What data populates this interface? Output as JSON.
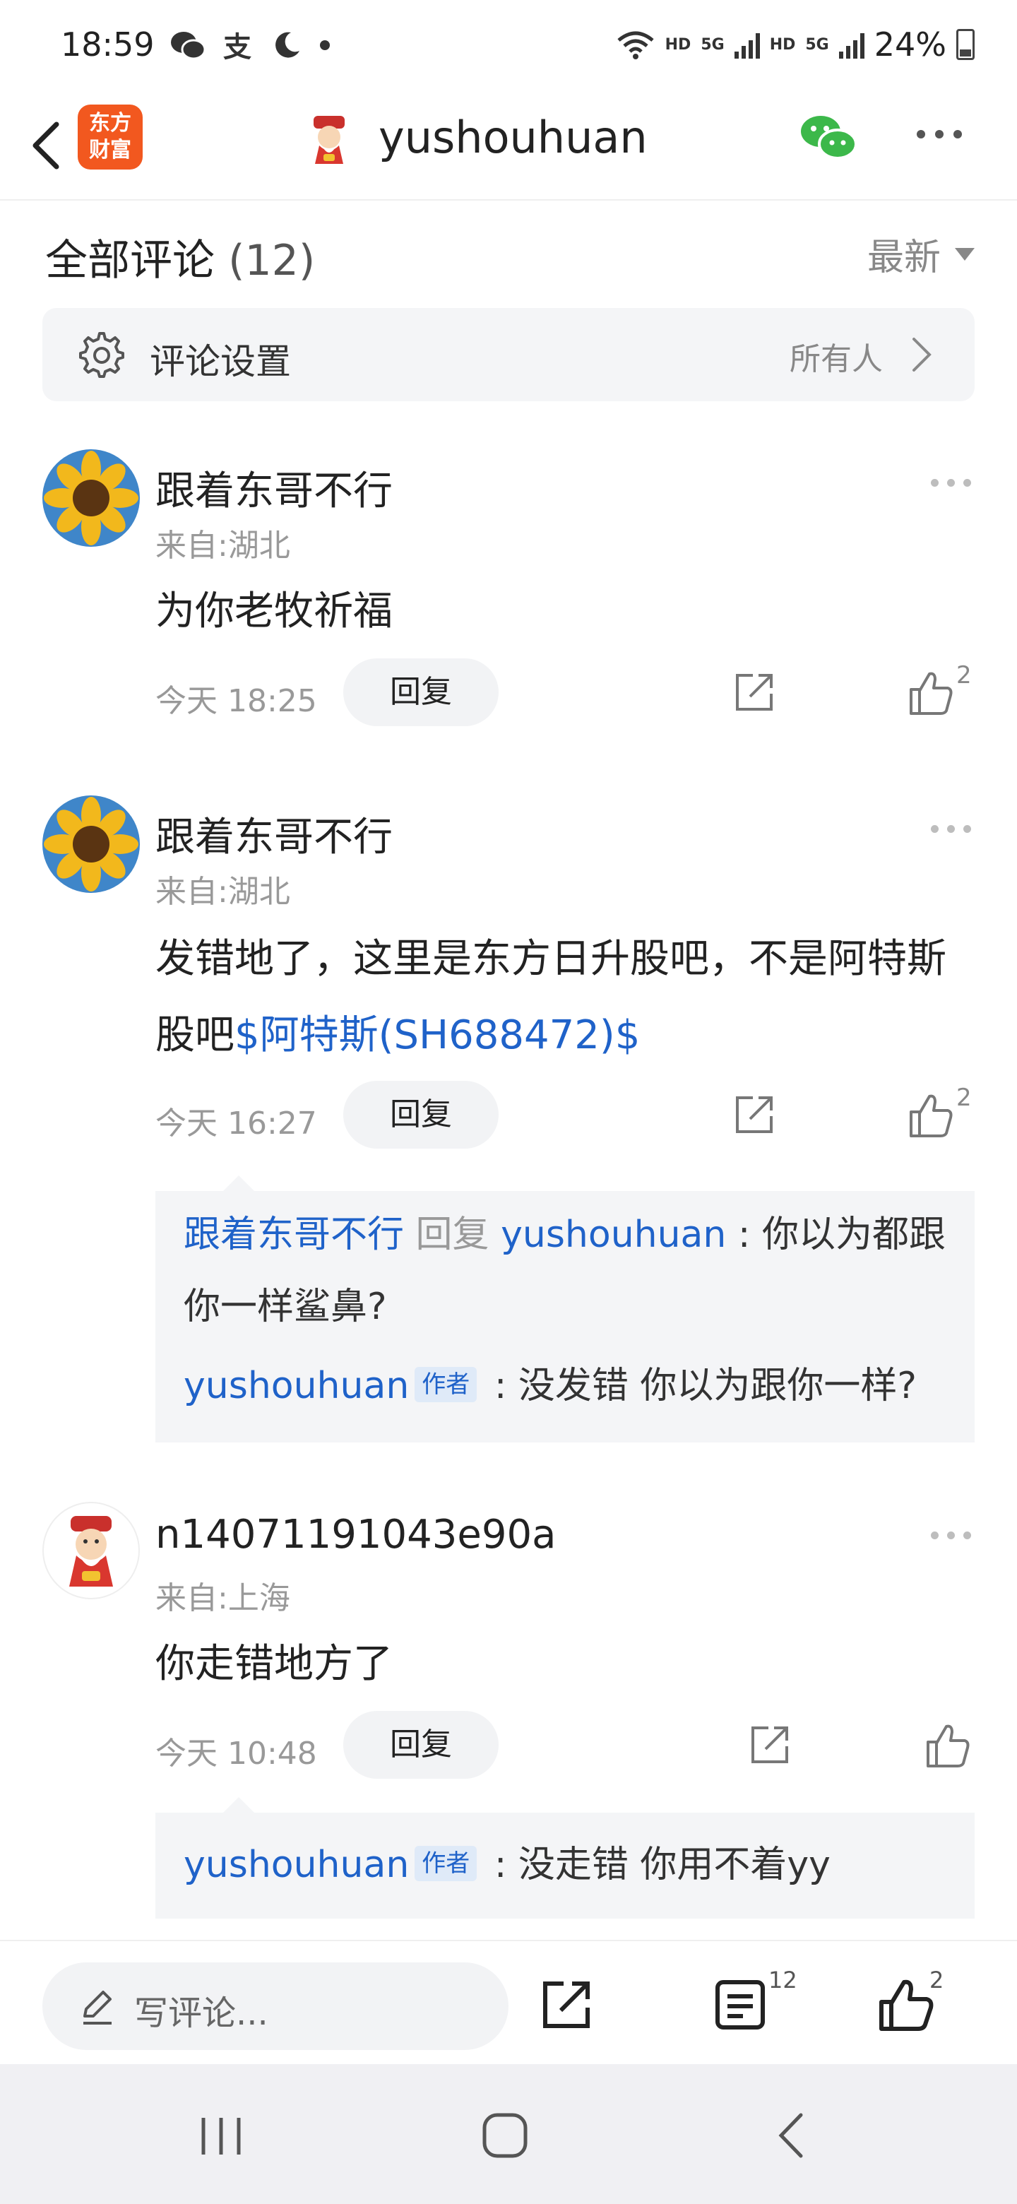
{
  "status_bar": {
    "time": "18:59",
    "left_icons": [
      "wechat-icon",
      "alipay-icon",
      "moon-icon",
      "dot-icon"
    ],
    "net_label_1": "HD",
    "net_label_2": "5G",
    "net_label_3": "HD",
    "net_label_4": "5G",
    "battery": "24%"
  },
  "header": {
    "brand_logo_line1": "东方",
    "brand_logo_line2": "财富",
    "title": "yushouhuan",
    "icons": [
      "back-icon",
      "wechat-share-icon",
      "more-icon"
    ]
  },
  "section": {
    "title": "全部评论",
    "count": "(12)",
    "sort": "最新"
  },
  "settings": {
    "label": "评论设置",
    "value": "所有人"
  },
  "comments": [
    {
      "name": "跟着东哥不行",
      "location": "来自:湖北",
      "body": "为你老牧祈福",
      "time": "今天 18:25",
      "reply_label": "回复",
      "likes": "2"
    },
    {
      "name": "跟着东哥不行",
      "location": "来自:湖北",
      "body_line1": "发错地了，这里是东方日升股吧，不是阿特斯",
      "body_line2_text": "股吧",
      "body_line2_stock": "$阿特斯(SH688472)$",
      "time": "今天 16:27",
      "reply_label": "回复",
      "likes": "2",
      "replies": [
        {
          "user": "跟着东哥不行",
          "verb": "回复",
          "target": "yushouhuan",
          "text_line1": " : 你以为都跟",
          "text_line2": "你一样鲨鼻?"
        },
        {
          "user": "yushouhuan",
          "tag": "作者",
          "text": " : 没发错  你以为跟你一样?"
        }
      ]
    },
    {
      "name": "n14071191043e90a",
      "location": "来自:上海",
      "body": "你走错地方了",
      "time": "今天 10:48",
      "reply_label": "回复",
      "replies": [
        {
          "user": "yushouhuan",
          "tag": "作者",
          "text": " : 没走错 你用不着yy"
        }
      ]
    }
  ],
  "bottom_bar": {
    "write_placeholder": "写评论...",
    "comment_count": "12",
    "like_count": "2"
  },
  "colors": {
    "link_blue": "#1f62c9",
    "brand_orange": "#f2581f",
    "muted_gray": "#999999",
    "panel_bg": "#f4f5f7"
  }
}
